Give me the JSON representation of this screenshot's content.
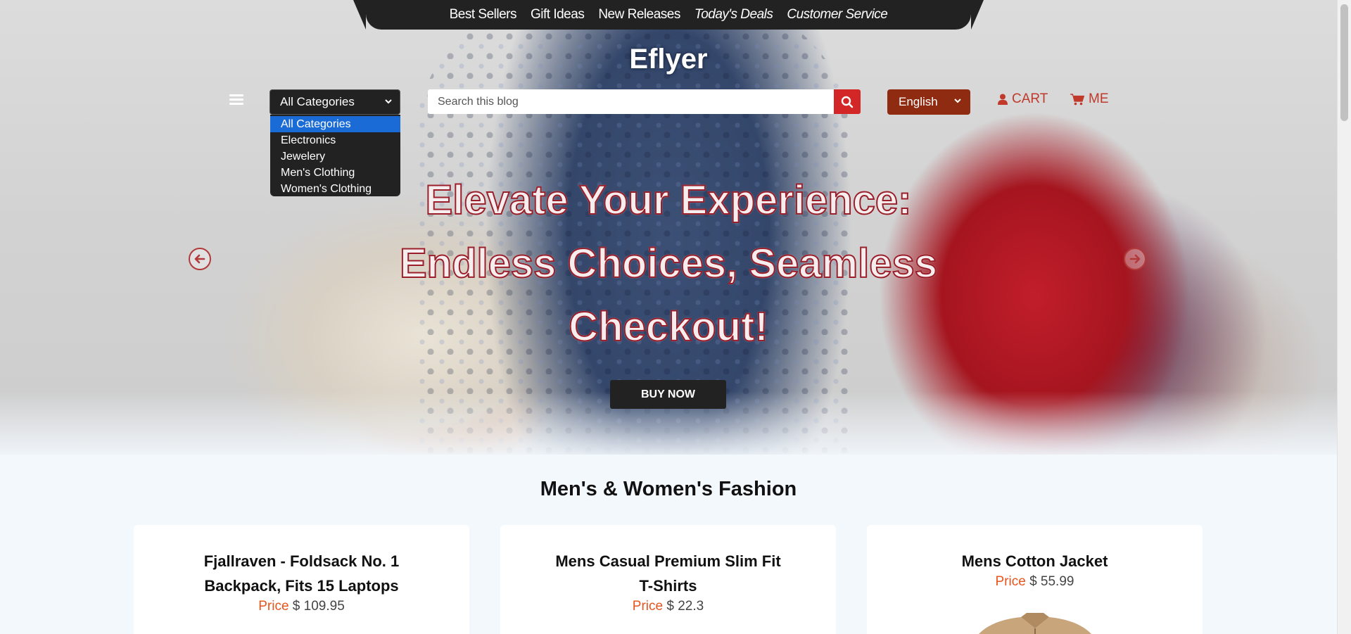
{
  "topnav": {
    "links": [
      {
        "label": "Best Sellers"
      },
      {
        "label": "Gift Ideas"
      },
      {
        "label": "New Releases"
      },
      {
        "label": "Today's Deals"
      },
      {
        "label": "Customer Service"
      }
    ]
  },
  "brand": "Eflyer",
  "category_select": {
    "selected": "All Categories",
    "options": [
      "All Categories",
      "Electronics",
      "Jewelery",
      "Men's Clothing",
      "Women's Clothing"
    ]
  },
  "search": {
    "placeholder": "Search this blog"
  },
  "language": {
    "selected": "English"
  },
  "cart_label": "CART",
  "me_label": "ME",
  "hero": {
    "line1": "Elevate Your Experience:",
    "line2": "Endless Choices, Seamless",
    "line3": "Checkout!",
    "cta": "BUY NOW"
  },
  "section_title": "Men's & Women's Fashion",
  "products": [
    {
      "name": "Fjallraven - Foldsack No. 1 Backpack, Fits 15 Laptops",
      "price_label": "Price",
      "price": "$ 109.95"
    },
    {
      "name": "Mens Casual Premium Slim Fit T-Shirts",
      "price_label": "Price",
      "price": "$ 22.3"
    },
    {
      "name": "Mens Cotton Jacket",
      "price_label": "Price",
      "price": "$ 55.99"
    }
  ],
  "colors": {
    "accent_red": "#d32626",
    "lang_bg": "#8f2b10",
    "price_label": "#e8541e"
  }
}
